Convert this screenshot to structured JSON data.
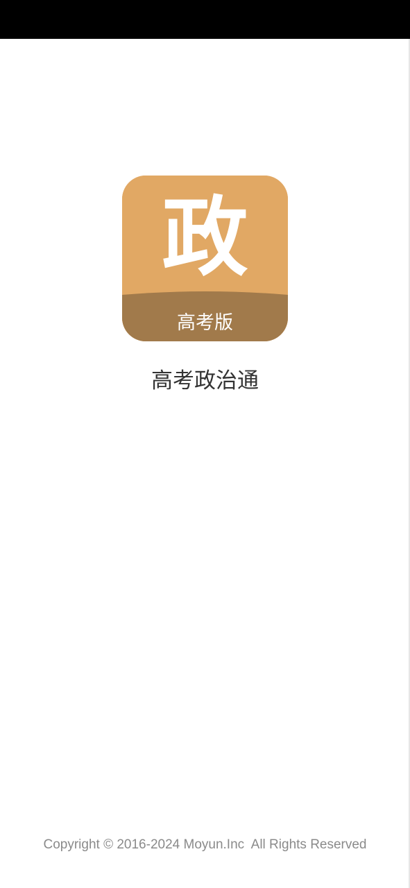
{
  "app": {
    "icon": {
      "glyph": "政",
      "band_text": "高考版",
      "top_color": "#e1a864",
      "band_color": "#a17a4b"
    },
    "name": "高考政治通"
  },
  "footer": {
    "copyright": "Copyright © 2016-2024 Moyun.Inc  All Rights Reserved"
  }
}
